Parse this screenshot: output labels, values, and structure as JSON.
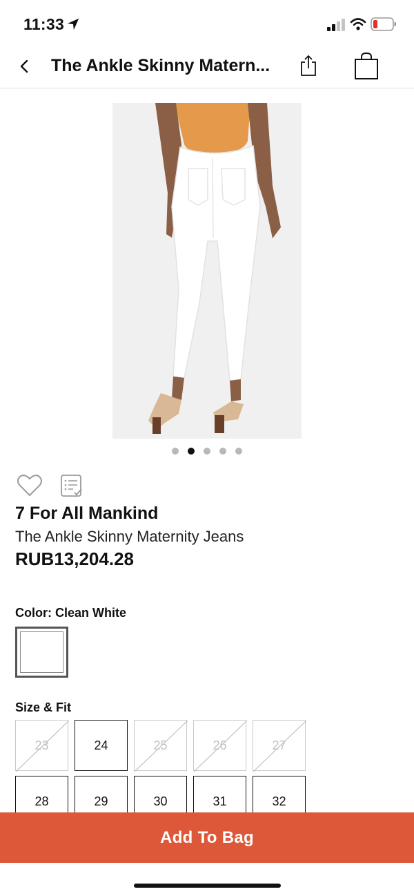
{
  "status_bar": {
    "time": "11:33",
    "icons": [
      "location-arrow-icon",
      "signal-icon",
      "wifi-icon",
      "battery-icon"
    ],
    "battery_color": "#e0312a"
  },
  "nav": {
    "back_icon": "chevron-left-icon",
    "title": "The Ankle Skinny Matern...",
    "share_icon": "share-icon",
    "bag_icon": "shopping-bag-icon"
  },
  "carousel": {
    "total": 5,
    "active_index": 1
  },
  "actions": {
    "favorite_icon": "heart-icon",
    "list_icon": "add-to-list-icon"
  },
  "product": {
    "brand": "7 For All Mankind",
    "name": "The Ankle Skinny Maternity Jeans",
    "price": "RUB13,204.28"
  },
  "color": {
    "label": "Color: Clean White",
    "swatch_color": "#ffffff"
  },
  "sizes": {
    "label": "Size & Fit",
    "row1": [
      {
        "size": "23",
        "available": false
      },
      {
        "size": "24",
        "available": true
      },
      {
        "size": "25",
        "available": false
      },
      {
        "size": "26",
        "available": false
      },
      {
        "size": "27",
        "available": false
      }
    ],
    "row2": [
      {
        "size": "28",
        "available": true
      },
      {
        "size": "29",
        "available": true
      },
      {
        "size": "30",
        "available": true
      },
      {
        "size": "31",
        "available": true
      },
      {
        "size": "32",
        "available": true
      }
    ]
  },
  "cta": {
    "label": "Add To Bag",
    "color": "#dd5838"
  }
}
